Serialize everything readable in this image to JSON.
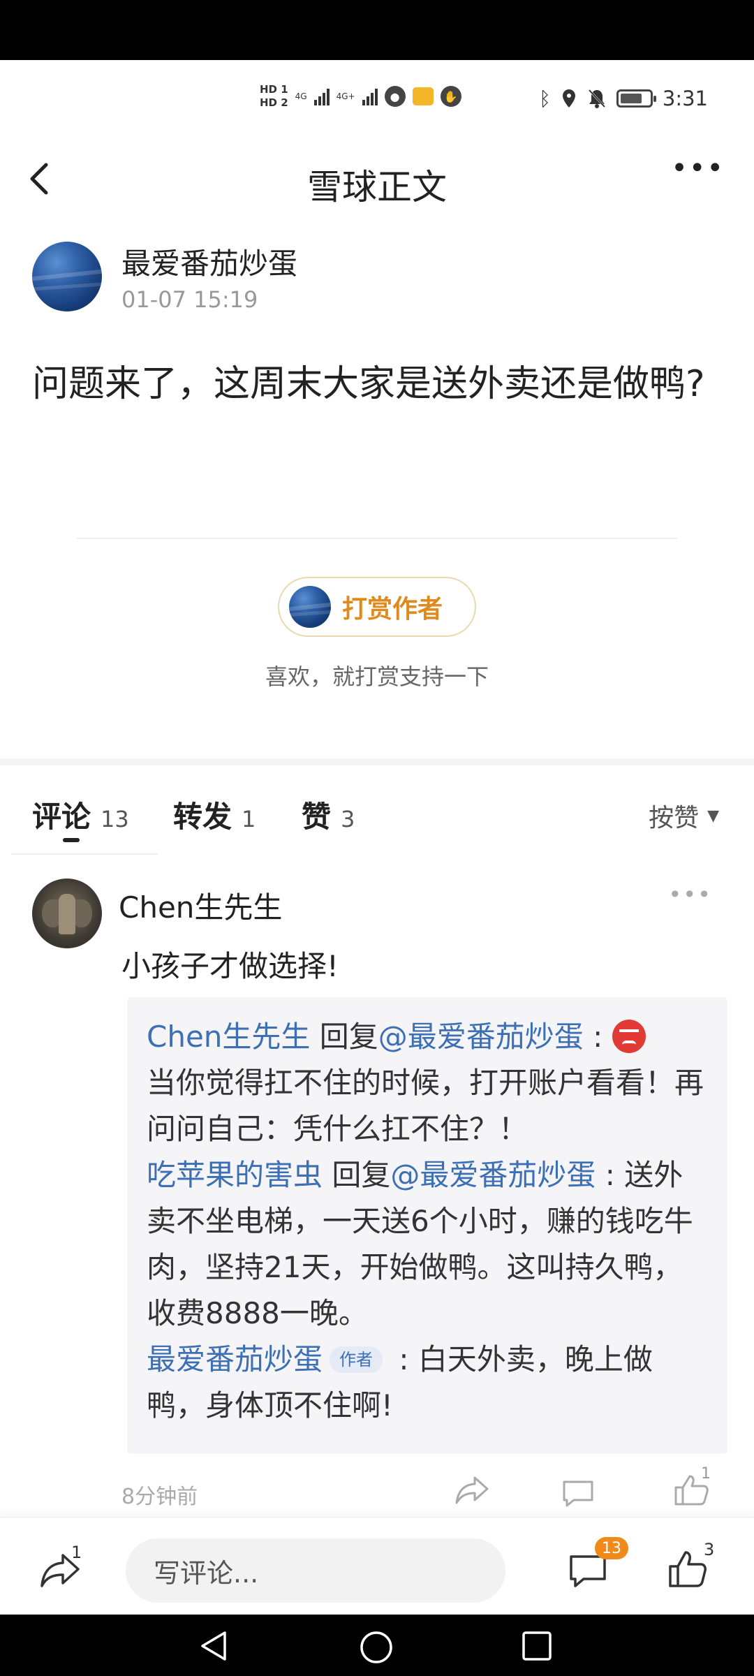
{
  "status_bar": {
    "hd1": "HD 1",
    "hd2": "HD 2",
    "net1": "4G",
    "net2": "4G+",
    "time": "3:31"
  },
  "header": {
    "title": "雪球正文"
  },
  "post": {
    "author": "最爱番茄炒蛋",
    "time": "01-07 15:19",
    "text": "问题来了，这周末大家是送外卖还是做鸭?"
  },
  "tip": {
    "button_label": "打赏作者",
    "subtext": "喜欢，就打赏支持一下"
  },
  "tabs": {
    "comments_label": "评论",
    "comments_count": "13",
    "reposts_label": "转发",
    "reposts_count": "1",
    "likes_label": "赞",
    "likes_count": "3",
    "sort_label": "按赞"
  },
  "comment": {
    "author": "Chen生先生",
    "text": "小孩子才做选择!",
    "time": "8分钟前",
    "like_count": "1",
    "replies": [
      {
        "who": "Chen生先生",
        "verb": " 回复",
        "at": "@最爱番茄炒蛋",
        "text": "当你觉得扛不住的时候，打开账户看看！再问问自己：凭什么扛不住？！"
      },
      {
        "who": "吃苹果的害虫",
        "verb": " 回复",
        "at": "@最爱番茄炒蛋",
        "text": "送外卖不坐电梯，一天送6个小时，赚的钱吃牛肉，坚持21天，开始做鸭。这叫持久鸭，收费8888一晚。"
      },
      {
        "who": "最爱番茄炒蛋",
        "badge": "作者",
        "text": "白天外卖，晚上做鸭，身体顶不住啊!"
      }
    ]
  },
  "bottom_bar": {
    "share_count": "1",
    "input_placeholder": "写评论...",
    "comment_badge": "13",
    "like_count": "3"
  },
  "colors": {
    "link_blue": "#3d6fb5",
    "tip_orange": "#e08a1e",
    "badge_orange": "#f08a1b"
  }
}
